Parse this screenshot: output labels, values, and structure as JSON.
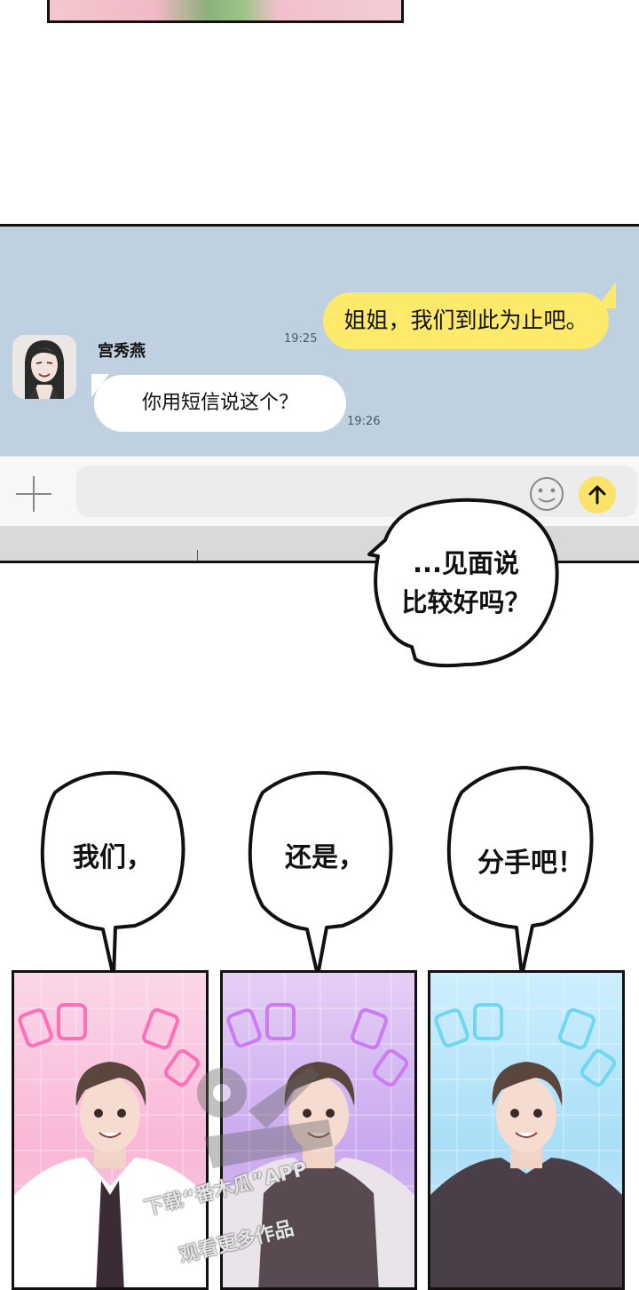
{
  "chat": {
    "message_sent": "姐姐，我们到此为止吧。",
    "message_sent_time": "19:25",
    "sender_name": "宫秀燕",
    "message_received": "你用短信说这个？",
    "message_received_time": "19:26"
  },
  "speech": {
    "meet_line1": "...见面说",
    "meet_line2": "比较好吗？",
    "bubble_1": "我们，",
    "bubble_2": "还是，",
    "bubble_3": "分手吧！"
  },
  "watermark": {
    "line_1": "下载“番木瓜”APP",
    "line_2": "观看更多作品"
  },
  "colors": {
    "chat_background": "#bfd1e1",
    "sent_bubble": "#fdea6a",
    "received_bubble": "#ffffff",
    "send_button": "#fbe26a"
  }
}
